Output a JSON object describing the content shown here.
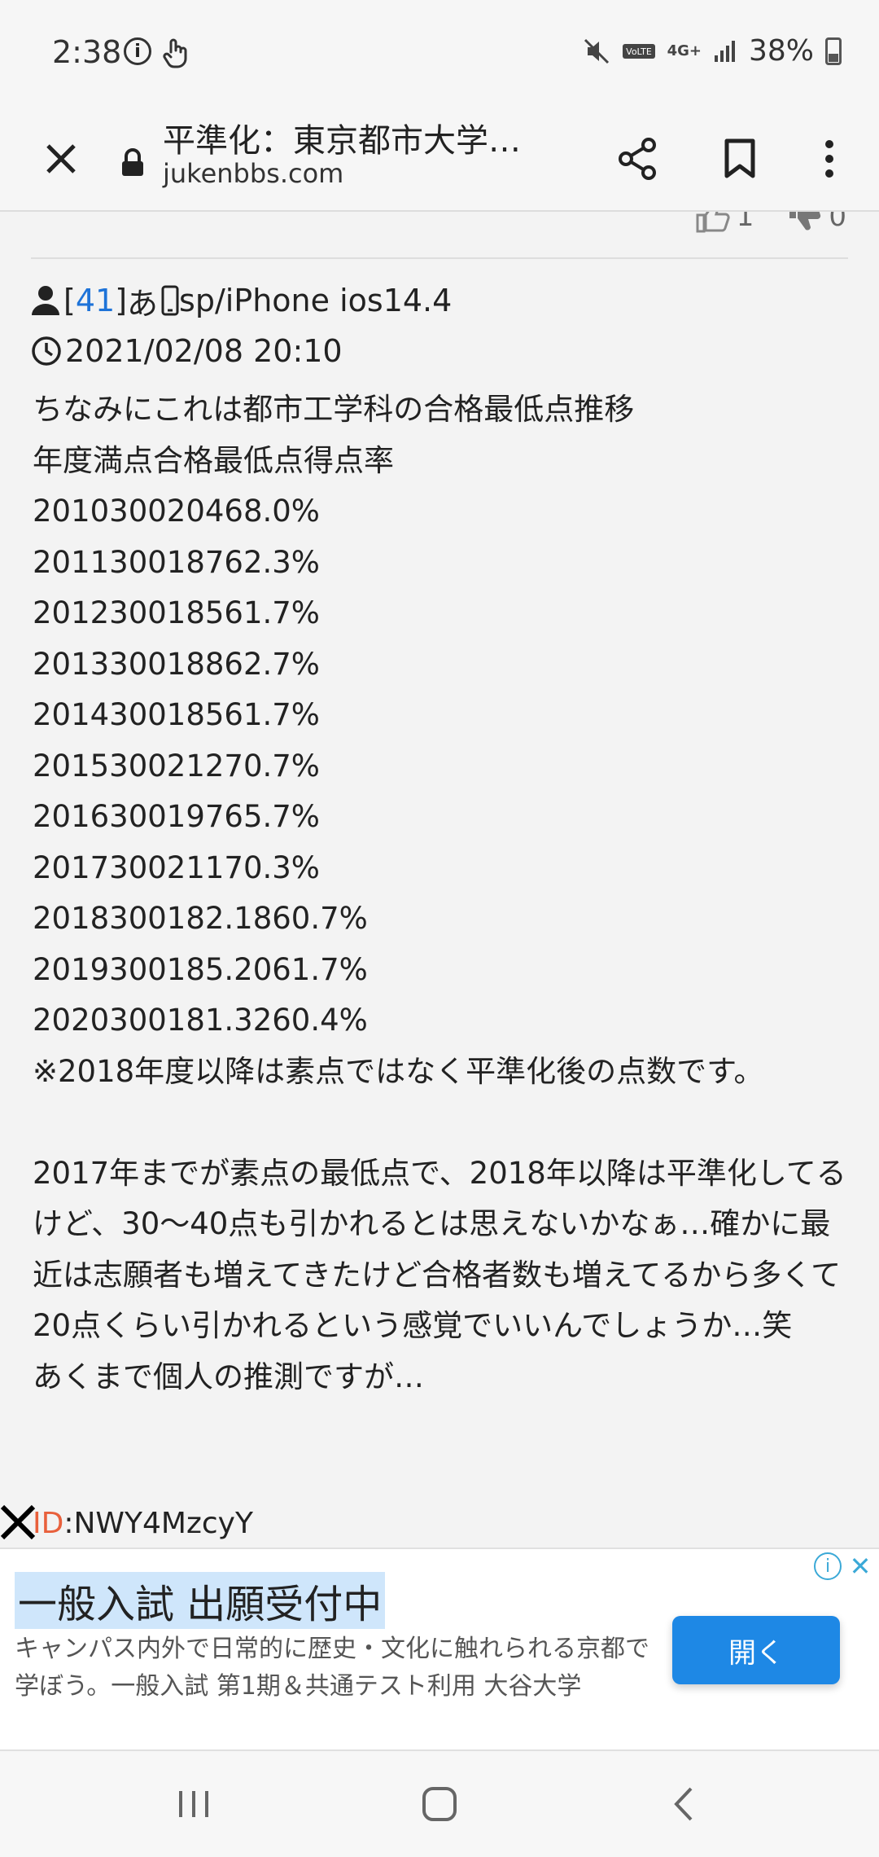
{
  "status_bar": {
    "time": "2:38",
    "battery_percent": "38%",
    "network_label": "4G+",
    "icons": [
      "info-icon",
      "touch-icon",
      "mute-icon",
      "volte-icon",
      "network-icon",
      "signal-icon",
      "battery-icon"
    ]
  },
  "toolbar": {
    "title": "平準化：東京都市大学…",
    "domain": "jukenbbs.com",
    "icons": [
      "close-icon",
      "lock-icon",
      "share-icon",
      "bookmark-icon",
      "more-icon"
    ]
  },
  "votes": {
    "up": "1",
    "down": "0"
  },
  "post": {
    "number": "41",
    "author": "あ",
    "device": "sp/iPhone ios14.4",
    "timestamp": "2021/02/08 20:10",
    "lines": [
      "ちなみにこれは都市工学科の合格最低点推移",
      "年度満点合格最低点得点率",
      "201030020468.0%",
      "201130018762.3%",
      "201230018561.7%",
      "201330018862.7%",
      "201430018561.7%",
      "201530021270.7%",
      "201630019765.7%",
      "201730021170.3%",
      "2018300182.1860.7%",
      "2019300185.2061.7%",
      "2020300181.3260.4%",
      "※2018年度以降は素点ではなく平準化後の点数です。"
    ],
    "paragraph": "2017年までが素点の最低点で、2018年以降は平準化してるけど、30〜40点も引かれるとは思えないかなぁ…確かに最近は志願者も増えてきたけど合格者数も増えてるから多くて20点くらい引かれるという感覚でいいんでしょうか…笑",
    "closing": "あくまで個人の推測ですが…",
    "id_label": "ID",
    "id_value": ":NWY4MzcyY"
  },
  "ad": {
    "headline": "一般入試 出願受付中",
    "description": "キャンパス内外で日常的に歴史・文化に触れられる京都で学ぼう。一般入試 第1期＆共通テスト利用 大谷大学",
    "button_label": "開く"
  },
  "colors": {
    "link": "#1e73d8",
    "id_label": "#e8603c",
    "ad_button": "#1e88e5",
    "ad_highlight": "#cfe6fb"
  }
}
